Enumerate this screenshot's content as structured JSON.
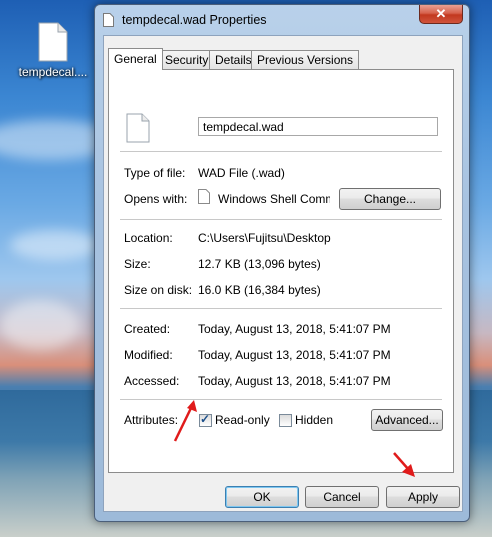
{
  "desktop": {
    "icon_label": "tempdecal...."
  },
  "window": {
    "title": "tempdecal.wad Properties",
    "close_glyph": "✕",
    "tabs": [
      {
        "label": "General"
      },
      {
        "label": "Security"
      },
      {
        "label": "Details"
      },
      {
        "label": "Previous Versions"
      }
    ]
  },
  "general": {
    "file_name": "tempdecal.wad",
    "type_of_file_label": "Type of file:",
    "type_of_file_value": "WAD File (.wad)",
    "opens_with_label": "Opens with:",
    "opens_with_value": "Windows Shell Commor",
    "change_button": "Change...",
    "location_label": "Location:",
    "location_value": "C:\\Users\\Fujitsu\\Desktop",
    "size_label": "Size:",
    "size_value": "12.7 KB (13,096 bytes)",
    "size_on_disk_label": "Size on disk:",
    "size_on_disk_value": "16.0 KB (16,384 bytes)",
    "created_label": "Created:",
    "created_value": "Today, August 13, 2018, 5:41:07 PM",
    "modified_label": "Modified:",
    "modified_value": "Today, August 13, 2018, 5:41:07 PM",
    "accessed_label": "Accessed:",
    "accessed_value": "Today, August 13, 2018, 5:41:07 PM",
    "attributes_label": "Attributes:",
    "readonly_label": "Read-only",
    "readonly_checked": true,
    "hidden_label": "Hidden",
    "hidden_checked": false,
    "advanced_button": "Advanced..."
  },
  "footer": {
    "ok_button": "OK",
    "cancel_button": "Cancel",
    "apply_button": "Apply"
  },
  "colors": {
    "annotation_arrow": "#e01b1b"
  }
}
